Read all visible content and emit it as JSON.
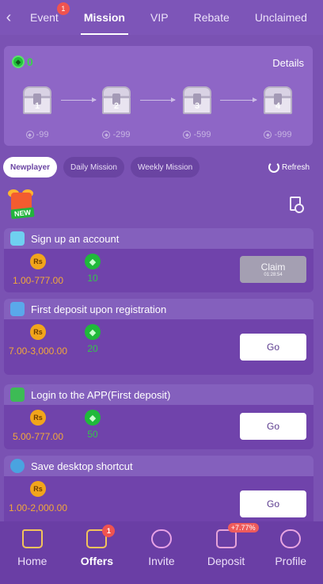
{
  "nav": {
    "tabs": [
      {
        "label": "Event",
        "badge": "1"
      },
      {
        "label": "Mission"
      },
      {
        "label": "VIP"
      },
      {
        "label": "Rebate"
      },
      {
        "label": "Unclaimed"
      }
    ],
    "active_tab": "Mission"
  },
  "chest_panel": {
    "points": "0",
    "details_label": "Details",
    "chests": [
      {
        "number": "1",
        "cost": "-99"
      },
      {
        "number": "2",
        "cost": "-299"
      },
      {
        "number": "3",
        "cost": "-599"
      },
      {
        "number": "4",
        "cost": "-999"
      }
    ]
  },
  "filters": {
    "items": [
      "Newplayer",
      "Daily Mission",
      "Weekly Mission"
    ],
    "active": "Newplayer",
    "refresh_label": "Refresh"
  },
  "gift_badge": "NEW",
  "missions": [
    {
      "title": "Sign up an account",
      "currency": "Rs",
      "amount": "1.00-777.00",
      "points": "10",
      "button": "Claim",
      "button_sub": "01:28:54"
    },
    {
      "title": "First deposit upon registration",
      "currency": "Rs",
      "amount": "7.00-3,000.00",
      "points": "20",
      "button": "Go"
    },
    {
      "title": "Login to the APP(First deposit)",
      "currency": "Rs",
      "amount": "5.00-777.00",
      "points": "50",
      "button": "Go"
    },
    {
      "title": "Save desktop shortcut",
      "currency": "Rs",
      "amount": "1.00-2,000.00",
      "points": "",
      "button": "Go"
    }
  ],
  "bottom_nav": {
    "items": [
      {
        "label": "Home"
      },
      {
        "label": "Offers",
        "badge": "1"
      },
      {
        "label": "Invite"
      },
      {
        "label": "Deposit",
        "badge": "+7.77%"
      },
      {
        "label": "Profile"
      }
    ],
    "active": "Offers"
  },
  "colors": {
    "background": "#7a52b3",
    "accent_gold": "#f2a51b",
    "accent_green": "#35c44b",
    "badge_red": "#ef5350"
  }
}
